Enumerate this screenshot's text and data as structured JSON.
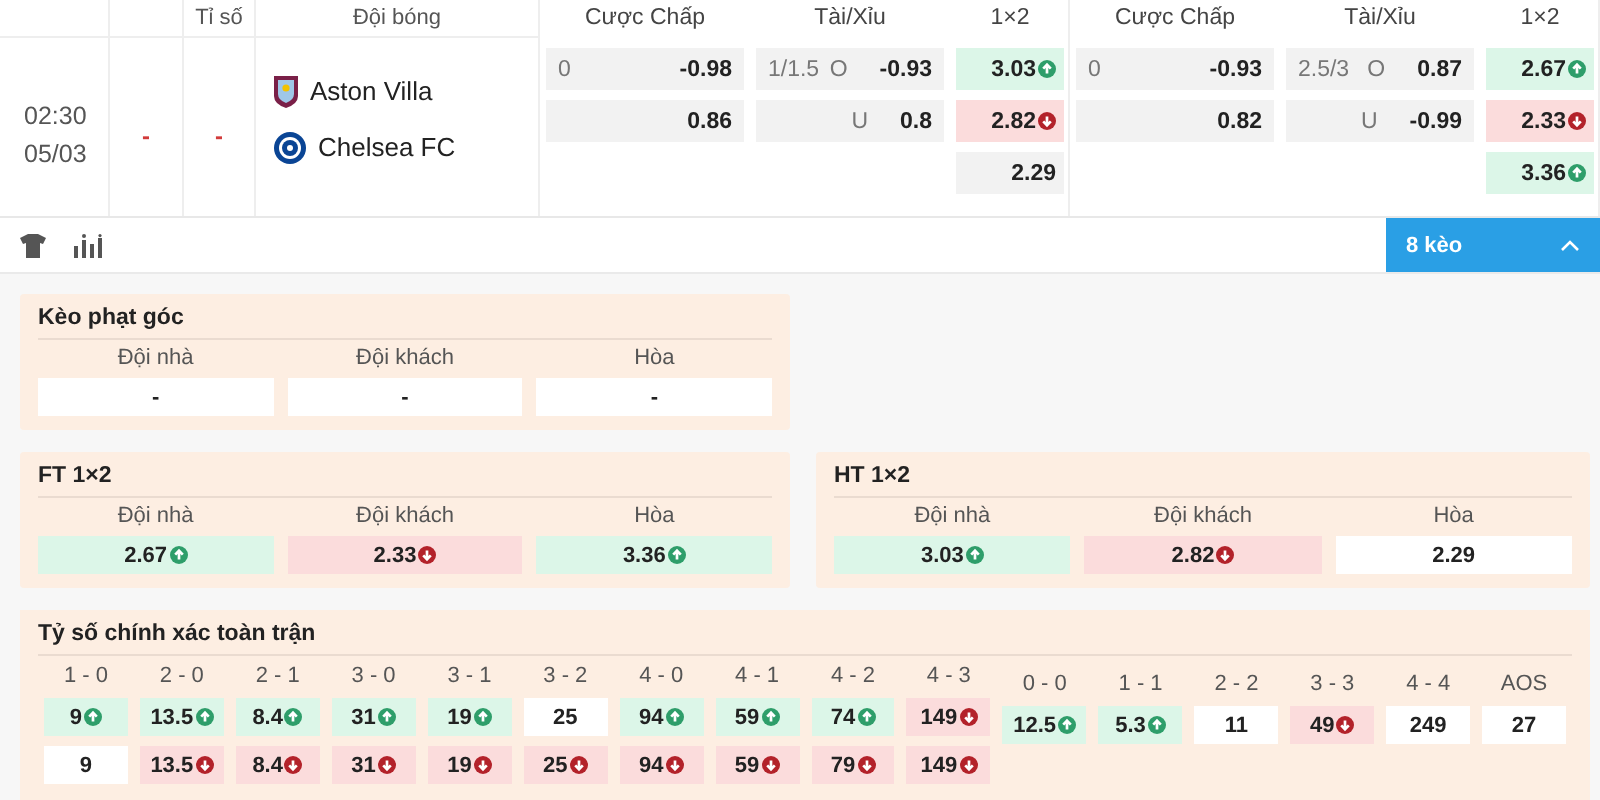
{
  "header": {
    "score_label": "Tỉ số",
    "team_label": "Đội bóng"
  },
  "match": {
    "time": "02:30",
    "date": "05/03",
    "home_score": "-",
    "away_score": "-",
    "teams": [
      {
        "name": "Aston Villa"
      },
      {
        "name": "Chelsea FC"
      }
    ]
  },
  "odds_groups": [
    {
      "handicap_label": "Cược Chấp",
      "ou_label": "Tài/Xỉu",
      "x12_label": "1×2",
      "handicap": [
        {
          "line": "0",
          "odds": "-0.98"
        },
        {
          "odds": "0.86"
        }
      ],
      "over_under": [
        {
          "line": "1/1.5",
          "side": "O",
          "odds": "-0.93"
        },
        {
          "side": "U",
          "odds": "0.8"
        }
      ],
      "x12": [
        {
          "value": "3.03",
          "rising": true,
          "falling": false
        },
        {
          "value": "2.82",
          "rising": false,
          "falling": true
        },
        {
          "value": "2.29",
          "rising": false,
          "falling": false
        }
      ]
    },
    {
      "handicap_label": "Cược Chấp",
      "ou_label": "Tài/Xỉu",
      "x12_label": "1×2",
      "handicap": [
        {
          "line": "0",
          "odds": "-0.93"
        },
        {
          "odds": "0.82"
        }
      ],
      "over_under": [
        {
          "line": "2.5/3",
          "side": "O",
          "odds": "0.87"
        },
        {
          "side": "U",
          "odds": "-0.99"
        }
      ],
      "x12": [
        {
          "value": "2.67",
          "rising": true,
          "falling": false
        },
        {
          "value": "2.33",
          "rising": false,
          "falling": true
        },
        {
          "value": "3.36",
          "rising": true,
          "falling": false
        }
      ]
    }
  ],
  "toolbar": {
    "markets_button": "8 kèo",
    "expanded": true
  },
  "panel_rows": [
    [
      {
        "title": "Kèo phạt góc",
        "columns": [
          {
            "label": "Đội nhà",
            "value": "-",
            "rising": false,
            "falling": false
          },
          {
            "label": "Đội khách",
            "value": "-",
            "rising": false,
            "falling": false
          },
          {
            "label": "Hòa",
            "value": "-",
            "rising": false,
            "falling": false
          }
        ]
      }
    ],
    [
      {
        "title": "FT 1×2",
        "columns": [
          {
            "label": "Đội nhà",
            "value": "2.67",
            "rising": true,
            "falling": false
          },
          {
            "label": "Đội khách",
            "value": "2.33",
            "rising": false,
            "falling": true
          },
          {
            "label": "Hòa",
            "value": "3.36",
            "rising": true,
            "falling": false
          }
        ]
      },
      {
        "title": "HT 1×2",
        "columns": [
          {
            "label": "Đội nhà",
            "value": "3.03",
            "rising": true,
            "falling": false
          },
          {
            "label": "Đội khách",
            "value": "2.82",
            "rising": false,
            "falling": true
          },
          {
            "label": "Hòa",
            "value": "2.29",
            "rising": false,
            "falling": false
          }
        ]
      }
    ]
  ],
  "exact_score": {
    "title": "Tỷ số chính xác toàn trận",
    "scores": [
      {
        "label": "1 - 0",
        "home": {
          "value": "9",
          "rising": true,
          "falling": false
        },
        "away": {
          "value": "9",
          "rising": false,
          "falling": false
        }
      },
      {
        "label": "2 - 0",
        "home": {
          "value": "13.5",
          "rising": true,
          "falling": false
        },
        "away": {
          "value": "13.5",
          "rising": false,
          "falling": true
        }
      },
      {
        "label": "2 - 1",
        "home": {
          "value": "8.4",
          "rising": true,
          "falling": false
        },
        "away": {
          "value": "8.4",
          "rising": false,
          "falling": true
        }
      },
      {
        "label": "3 - 0",
        "home": {
          "value": "31",
          "rising": true,
          "falling": false
        },
        "away": {
          "value": "31",
          "rising": false,
          "falling": true
        }
      },
      {
        "label": "3 - 1",
        "home": {
          "value": "19",
          "rising": true,
          "falling": false
        },
        "away": {
          "value": "19",
          "rising": false,
          "falling": true
        }
      },
      {
        "label": "3 - 2",
        "home": {
          "value": "25",
          "rising": false,
          "falling": false
        },
        "away": {
          "value": "25",
          "rising": false,
          "falling": true
        }
      },
      {
        "label": "4 - 0",
        "home": {
          "value": "94",
          "rising": true,
          "falling": false
        },
        "away": {
          "value": "94",
          "rising": false,
          "falling": true
        }
      },
      {
        "label": "4 - 1",
        "home": {
          "value": "59",
          "rising": true,
          "falling": false
        },
        "away": {
          "value": "59",
          "rising": false,
          "falling": true
        }
      },
      {
        "label": "4 - 2",
        "home": {
          "value": "74",
          "rising": true,
          "falling": false
        },
        "away": {
          "value": "79",
          "rising": false,
          "falling": true
        }
      },
      {
        "label": "4 - 3",
        "home": {
          "value": "149",
          "rising": false,
          "falling": true
        },
        "away": {
          "value": "149",
          "rising": false,
          "falling": true
        }
      }
    ],
    "draws": [
      {
        "label": "0 - 0",
        "value": "12.5",
        "rising": true,
        "falling": false
      },
      {
        "label": "1 - 1",
        "value": "5.3",
        "rising": true,
        "falling": false
      },
      {
        "label": "2 - 2",
        "value": "11",
        "rising": false,
        "falling": false
      },
      {
        "label": "3 - 3",
        "value": "49",
        "rising": false,
        "falling": true
      },
      {
        "label": "4 - 4",
        "value": "249",
        "rising": false,
        "falling": false
      },
      {
        "label": "AOS",
        "value": "27",
        "rising": false,
        "falling": false
      }
    ]
  }
}
